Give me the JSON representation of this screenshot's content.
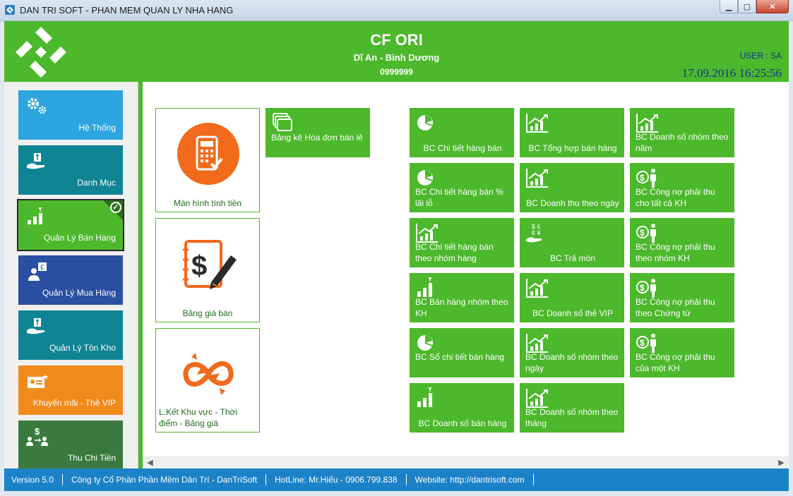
{
  "window": {
    "title": "DAN TRI SOFT - PHAN MEM QUAN LY NHA HANG"
  },
  "header": {
    "company": "CF ORI",
    "address": "Dĩ An - Bình Dương",
    "phone": "0999999",
    "user": "USER : SA",
    "datetime": "17.09.2016 16:25:56"
  },
  "sidebar": [
    {
      "label": "Hệ Thống",
      "icon": "gears-icon",
      "color": "#2da5e0"
    },
    {
      "label": "Danh Mục",
      "icon": "hand-box-icon",
      "color": "#0f8495"
    },
    {
      "label": "Quản Lý Bán Hàng",
      "icon": "bar-chart-icon",
      "color": "#4cb82b",
      "active": true
    },
    {
      "label": "Quản Lý Mua Hàng",
      "icon": "purchase-icon",
      "color": "#2a4fa3"
    },
    {
      "label": "Quản Lý Tồn Kho",
      "icon": "hand-box-icon",
      "color": "#0f8495"
    },
    {
      "label": "Khuyến mãi - Thẻ VIP",
      "icon": "vip-card-icon",
      "color": "#f28a1b"
    },
    {
      "label": "Thu Chi Tiền",
      "icon": "money-transfer-icon",
      "color": "#3a7a3e"
    }
  ],
  "big_tiles": [
    {
      "label": "Màn hình tính tiền",
      "icon": "pos-terminal-icon"
    },
    {
      "label": "Bảng giá bán",
      "icon": "price-list-icon"
    },
    {
      "label": "L.Kết Khu vực - Thời điểm - Bảng giá",
      "icon": "link-arrows-icon"
    }
  ],
  "small_tile": {
    "label": "Bảng kê Hóa đơn bán lẻ",
    "icon": "documents-icon"
  },
  "reports": [
    {
      "label": "BC Chi tiết hàng bán",
      "icon": "pie-icon"
    },
    {
      "label": "BC Tổng hợp bán hàng",
      "icon": "growth-chart-icon"
    },
    {
      "label": "BC Doanh số nhóm theo năm",
      "icon": "growth-chart-icon"
    },
    {
      "label": "BC Chi tiết hàng bán % lãi lỗ",
      "icon": "pie-icon"
    },
    {
      "label": "BC Doanh thu theo ngày",
      "icon": "growth-chart-icon"
    },
    {
      "label": "BC Công nợ phải thu cho tất cả KH",
      "icon": "person-coin-icon"
    },
    {
      "label": "BC Chi tiết hàng bán theo nhóm hàng",
      "icon": "growth-chart-icon"
    },
    {
      "label": "BC Trả món",
      "icon": "currency-hand-icon"
    },
    {
      "label": "BC Công nợ phải thu theo nhóm KH",
      "icon": "person-coin-icon"
    },
    {
      "label": "BC Bán hàng nhóm theo KH",
      "icon": "bar-chart-icon"
    },
    {
      "label": "BC Doanh số thẻ VIP",
      "icon": "growth-chart-icon"
    },
    {
      "label": "BC Công nợ phải thu theo Chứng từ",
      "icon": "person-coin-icon"
    },
    {
      "label": "BC Sổ chi tiết bán hàng",
      "icon": "pie-icon"
    },
    {
      "label": "BC Doanh số nhóm theo ngày",
      "icon": "growth-chart-icon"
    },
    {
      "label": "BC Công nợ phải thu của một KH",
      "icon": "person-coin-icon"
    },
    {
      "label": "BC Doanh số bán hàng",
      "icon": "bar-chart-icon"
    },
    {
      "label": "BC Doanh số nhóm theo tháng",
      "icon": "growth-chart-icon"
    }
  ],
  "status": {
    "version": "Version 5.0",
    "company": "Công ty Cổ Phần Phần Mềm Dân Trí - DanTriSoft",
    "hotline": "HotLine: Mr.Hiếu - 0906.799.838",
    "website": "Website: http://dantrisoft.com"
  }
}
